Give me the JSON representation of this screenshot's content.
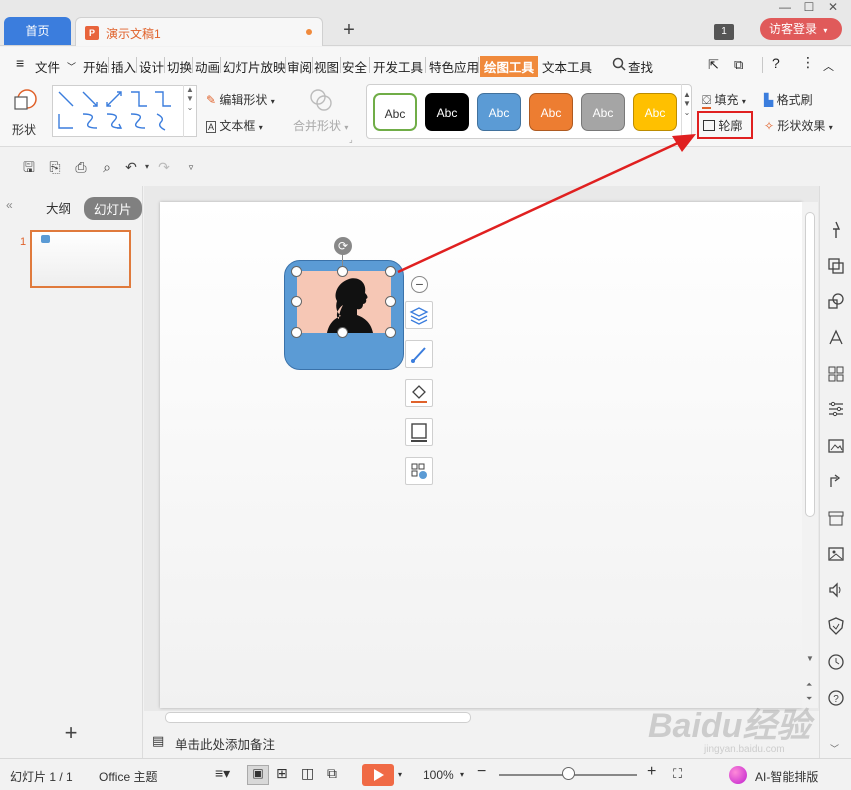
{
  "titlebar": {
    "home_tab": "首页",
    "doc_tab": "演示文稿1",
    "doc_icon_letter": "P",
    "window_count": "1",
    "login": "访客登录"
  },
  "menu": {
    "file": "文件",
    "items": [
      "开始",
      "插入",
      "设计",
      "切换",
      "动画",
      "幻灯片放映",
      "审阅",
      "视图",
      "安全",
      "开发工具",
      "特色应用",
      "绘图工具",
      "文本工具"
    ],
    "search": "查找"
  },
  "ribbon": {
    "shape_label": "形状",
    "edit_shape": "编辑形状",
    "text_box": "文本框",
    "merge_shape": "合并形状",
    "style_presets": [
      {
        "label": "Abc",
        "bg": "#ffffff",
        "fg": "#333333",
        "border": "#70ad47"
      },
      {
        "label": "Abc",
        "bg": "#000000",
        "fg": "#ffffff",
        "border": "#000000"
      },
      {
        "label": "Abc",
        "bg": "#5b9bd5",
        "fg": "#ffffff",
        "border": "#41719c"
      },
      {
        "label": "Abc",
        "bg": "#ed7d31",
        "fg": "#ffffff",
        "border": "#ae5a21"
      },
      {
        "label": "Abc",
        "bg": "#a5a5a5",
        "fg": "#ffffff",
        "border": "#787878"
      },
      {
        "label": "Abc",
        "bg": "#ffc000",
        "fg": "#ffffff",
        "border": "#bc8c00"
      }
    ],
    "fill": "填充",
    "format_painter": "格式刷",
    "outline": "轮廓",
    "shape_effect": "形状效果"
  },
  "left_panel": {
    "outline_tab": "大纲",
    "slides_tab": "幻灯片",
    "slide_number": "1"
  },
  "notes": {
    "placeholder": "单击此处添加备注"
  },
  "status": {
    "slide_counter": "幻灯片 1 / 1",
    "theme": "Office 主题",
    "zoom": "100%",
    "ai": "AI-智能排版"
  },
  "watermark": {
    "brand": "Baidu经验",
    "url": "jingyan.baidu.com"
  }
}
